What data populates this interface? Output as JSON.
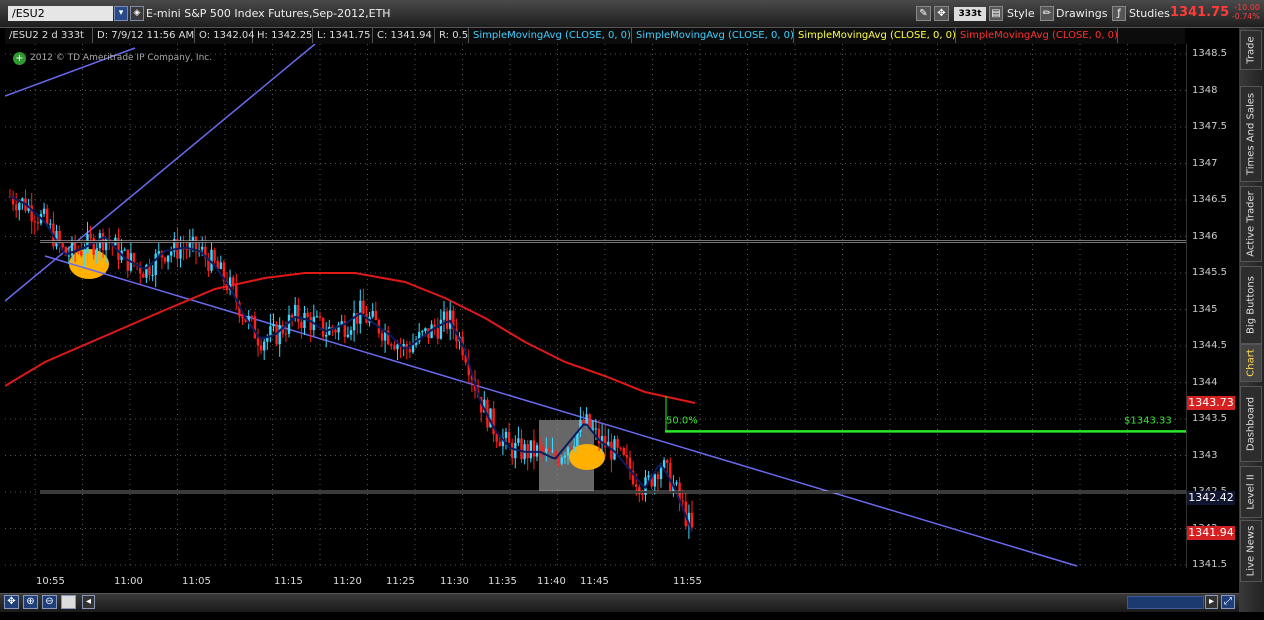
{
  "toolbar": {
    "symbol": "/ESU2",
    "description": "E-mini S&P 500 Index Futures,Sep-2012,ETH",
    "aggregation": "333t",
    "style_label": "Style",
    "drawings_label": "Drawings",
    "studies_label": "Studies",
    "last_price": "1341.75",
    "change_abs": "-10.00",
    "change_pct": "-0.74%"
  },
  "status": {
    "symbol_period": "/ESU2 2 d 333t",
    "datetime": "D: 7/9/12 11:56 AM",
    "open": "O: 1342.04",
    "high": "H: 1342.25",
    "low": "L: 1341.75",
    "close": "C: 1341.94",
    "range": "R: 0.5",
    "studies": [
      {
        "label": "SimpleMovingAvg (CLOSE, 0, 0)",
        "color": "#3fd0ff"
      },
      {
        "label": "SimpleMovingAvg (CLOSE, 0, 0)",
        "color": "#3fd0ff"
      },
      {
        "label": "SimpleMovingAvg (CLOSE, 0, 0)",
        "color": "#ffff40"
      },
      {
        "label": "SimpleMovingAvg (CLOSE, 0, 0)",
        "color": "#ff3030"
      }
    ]
  },
  "copyright": "2012 © TD Ameritrade IP Company, Inc.",
  "side_tabs": [
    "Trade",
    "Times And Sales",
    "Active Trader",
    "Big Buttons",
    "Chart",
    "Dashboard",
    "Level II",
    "Live News"
  ],
  "chart_data": {
    "type": "bar",
    "y_ticks": [
      "1348.5",
      "1348",
      "1347.5",
      "1347",
      "1346.5",
      "1346",
      "1345.5",
      "1345",
      "1344.5",
      "1344",
      "1343.5",
      "1343",
      "1342.5",
      "1342",
      "1341.5"
    ],
    "x_ticks": [
      "10:55",
      "11:00",
      "11:05",
      "11:15",
      "11:20",
      "11:25",
      "11:30",
      "11:35",
      "11:40",
      "11:45",
      "11:55"
    ],
    "price_labels": [
      {
        "text": "1343.73",
        "bg": "#d42020"
      },
      {
        "text": "1342.42",
        "bg": "#101530"
      },
      {
        "text": "1341.94",
        "bg": "#d42020"
      }
    ],
    "fib_label": "50.0%",
    "level_label": "$1343.33",
    "horizontal_levels": [
      1345.93,
      1342.5
    ],
    "green_level": 1343.33,
    "series_colors": {
      "up": "#39d7ff",
      "down": "#ff1e1e",
      "sma_short": "#0b1650",
      "sma_long": "#e01818",
      "trend": "#6a6af0"
    }
  }
}
